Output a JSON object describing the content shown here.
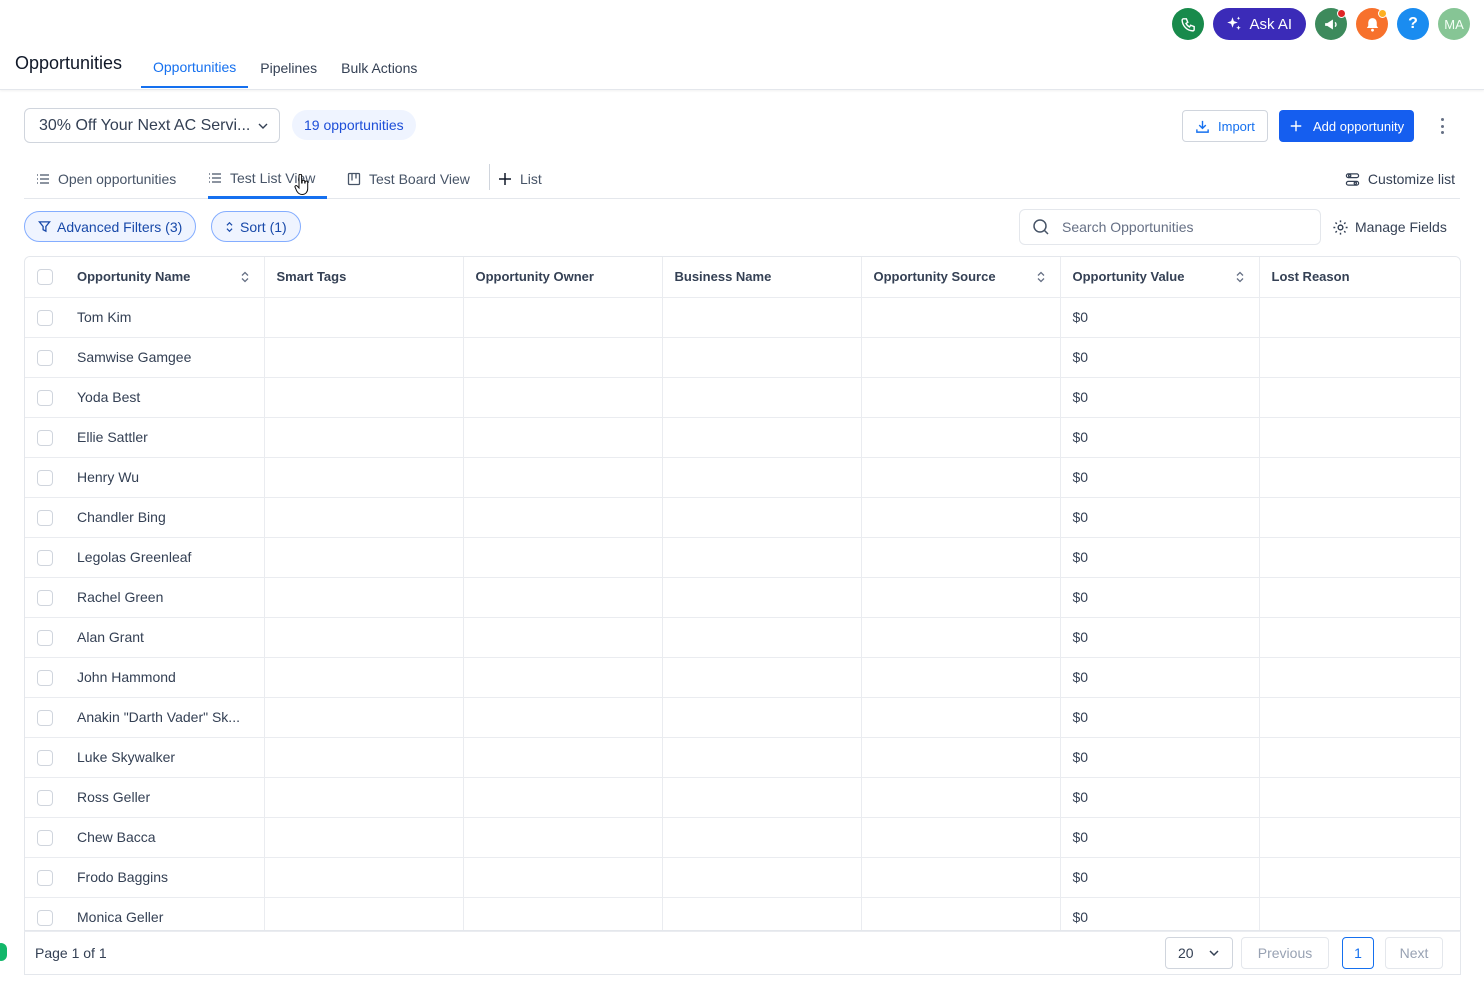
{
  "header": {
    "title": "Opportunities",
    "tabs": [
      {
        "label": "Opportunities",
        "active": true
      },
      {
        "label": "Pipelines",
        "active": false
      },
      {
        "label": "Bulk Actions",
        "active": false
      }
    ],
    "ask_ai_label": "Ask AI",
    "avatar_initials": "MA",
    "help_label": "?",
    "colors": {
      "phone": "#188a4b",
      "ask_ai": "#3b2bb8",
      "megaphone": "#3d8a5c",
      "bell": "#f7712c",
      "help": "#1a8cf0",
      "avatar": "#86c595"
    }
  },
  "toolbar": {
    "pipeline_value": "30% Off Your Next AC Servi...",
    "count_badge": "19 opportunities",
    "import_label": "Import",
    "add_label": "Add opportunity"
  },
  "views": {
    "tabs": [
      {
        "label": "Open opportunities",
        "icon": "list-icon",
        "active": false
      },
      {
        "label": "Test List View",
        "icon": "list-icon",
        "active": true
      },
      {
        "label": "Test Board View",
        "icon": "board-icon",
        "active": false
      },
      {
        "label": "List",
        "icon": "plus-icon",
        "active": false
      }
    ],
    "customize_label": "Customize list"
  },
  "filters": {
    "advanced_label": "Advanced Filters (3)",
    "sort_label": "Sort (1)",
    "search_placeholder": "Search Opportunities",
    "manage_fields_label": "Manage Fields"
  },
  "table": {
    "columns": [
      {
        "label": "Opportunity Name",
        "sortable": true
      },
      {
        "label": "Smart Tags",
        "sortable": false
      },
      {
        "label": "Opportunity Owner",
        "sortable": false
      },
      {
        "label": "Business Name",
        "sortable": false
      },
      {
        "label": "Opportunity Source",
        "sortable": true
      },
      {
        "label": "Opportunity Value",
        "sortable": true
      },
      {
        "label": "Lost Reason",
        "sortable": false
      }
    ],
    "rows": [
      {
        "name": "Tom Kim",
        "value": "$0"
      },
      {
        "name": "Samwise Gamgee",
        "value": "$0"
      },
      {
        "name": "Yoda Best",
        "value": "$0"
      },
      {
        "name": "Ellie Sattler",
        "value": "$0"
      },
      {
        "name": "Henry Wu",
        "value": "$0"
      },
      {
        "name": "Chandler Bing",
        "value": "$0"
      },
      {
        "name": "Legolas Greenleaf",
        "value": "$0"
      },
      {
        "name": "Rachel Green",
        "value": "$0"
      },
      {
        "name": "Alan Grant",
        "value": "$0"
      },
      {
        "name": "John Hammond",
        "value": "$0"
      },
      {
        "name": "Anakin \"Darth Vader\" Sk...",
        "value": "$0"
      },
      {
        "name": "Luke Skywalker",
        "value": "$0"
      },
      {
        "name": "Ross Geller",
        "value": "$0"
      },
      {
        "name": "Chew Bacca",
        "value": "$0"
      },
      {
        "name": "Frodo Baggins",
        "value": "$0"
      },
      {
        "name": "Monica Geller",
        "value": "$0"
      }
    ]
  },
  "pagination": {
    "page_text": "Page 1 of 1",
    "per_page": "20",
    "previous_label": "Previous",
    "current_page": "1",
    "next_label": "Next"
  }
}
